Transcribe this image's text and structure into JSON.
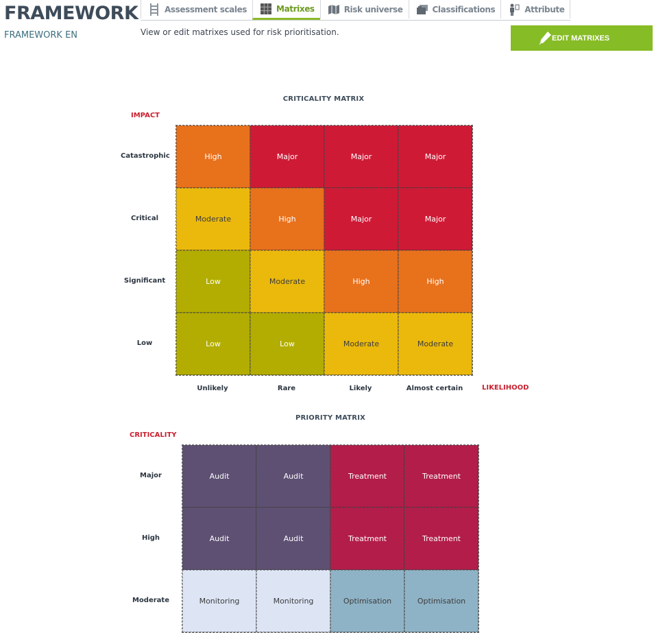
{
  "header": {
    "title": "FRAMEWORK",
    "subtitle": "FRAMEWORK EN",
    "description": "View or edit matrixes used for risk prioritisation.",
    "edit_button": "EDIT MATRIXES"
  },
  "tabs": [
    {
      "label": "Assessment scales",
      "icon": "ladder-icon",
      "active": false
    },
    {
      "label": "Matrixes",
      "icon": "grid-icon",
      "active": true
    },
    {
      "label": "Risk universe",
      "icon": "map-icon",
      "active": false
    },
    {
      "label": "Classifications",
      "icon": "folders-icon",
      "active": false
    },
    {
      "label": "Attribute",
      "icon": "person-attribute-icon",
      "active": false
    }
  ],
  "criticality": {
    "title": "CRITICALITY MATRIX",
    "y_axis": "IMPACT",
    "x_axis": "LIKELIHOOD",
    "rows": [
      "Catastrophic",
      "Critical",
      "Significant",
      "Low"
    ],
    "cols": [
      "Unlikely",
      "Rare",
      "Likely",
      "Almost certain"
    ],
    "cells": [
      [
        "High",
        "Major",
        "Major",
        "Major"
      ],
      [
        "Moderate",
        "High",
        "Major",
        "Major"
      ],
      [
        "Low",
        "Moderate",
        "High",
        "High"
      ],
      [
        "Low",
        "Low",
        "Moderate",
        "Moderate"
      ]
    ]
  },
  "priority": {
    "title": "PRIORITY MATRIX",
    "y_axis": "CRITICALITY",
    "rows": [
      "Major",
      "High",
      "Moderate"
    ],
    "cells": [
      [
        "Audit",
        "Audit",
        "Treatment",
        "Treatment"
      ],
      [
        "Audit",
        "Audit",
        "Treatment",
        "Treatment"
      ],
      [
        "Monitoring",
        "Monitoring",
        "Optimisation",
        "Optimisation"
      ]
    ]
  },
  "colors": {
    "accent": "#86bc25",
    "Major": "#cf1a36",
    "High": "#e8711c",
    "Moderate": "#ebb90c",
    "Low": "#b2ad00",
    "Audit": "#5e5073",
    "Treatment": "#b31d4a",
    "Monitoring": "#dde5f5",
    "Optimisation": "#8fb3c6"
  }
}
